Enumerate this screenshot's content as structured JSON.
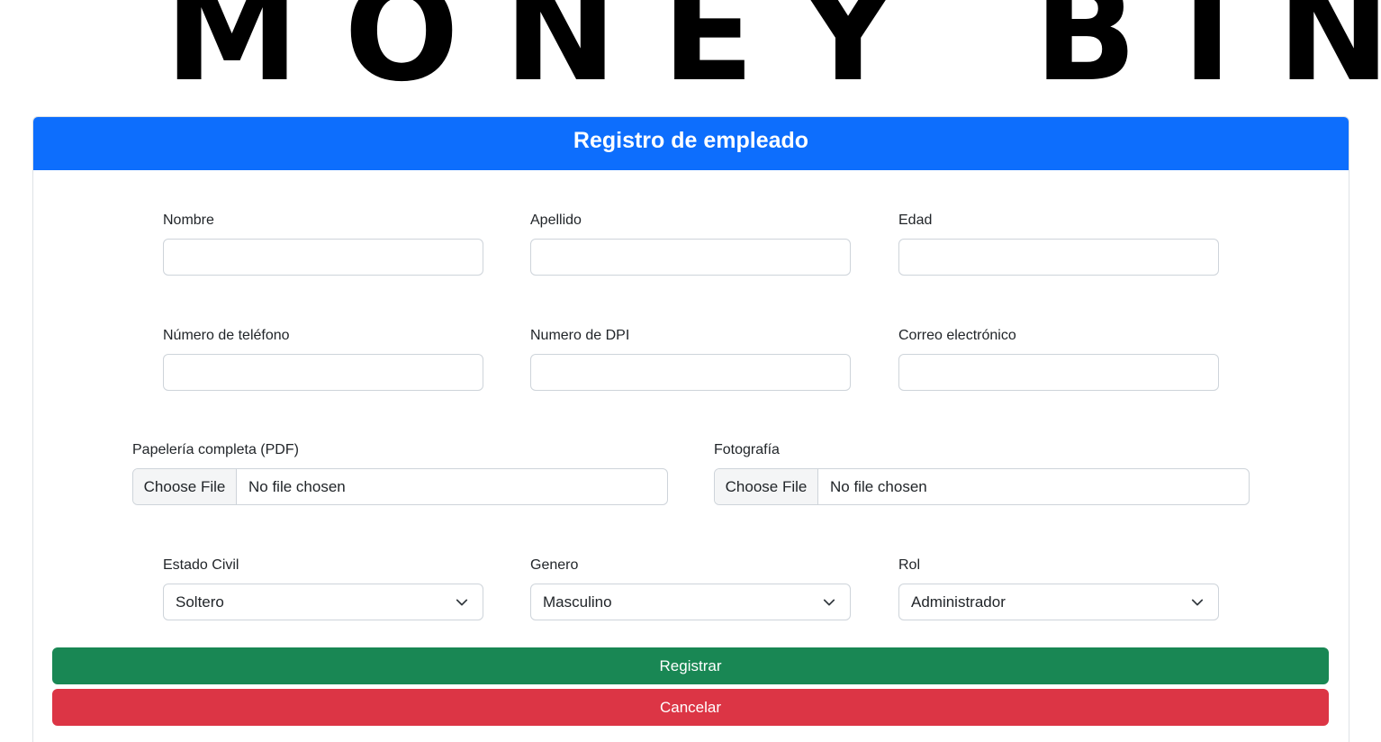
{
  "logo": {
    "text": "MONEY BIN"
  },
  "form": {
    "title": "Registro de empleado",
    "fields": {
      "nombre": {
        "label": "Nombre",
        "value": ""
      },
      "apellido": {
        "label": "Apellido",
        "value": ""
      },
      "edad": {
        "label": "Edad",
        "value": ""
      },
      "telefono": {
        "label": "Número de teléfono",
        "value": ""
      },
      "dpi": {
        "label": "Numero de DPI",
        "value": ""
      },
      "correo": {
        "label": "Correo electrónico",
        "value": ""
      }
    },
    "files": {
      "papeleria": {
        "label": "Papelería completa (PDF)",
        "button": "Choose File",
        "status": "No file chosen"
      },
      "fotografia": {
        "label": "Fotografía",
        "button": "Choose File",
        "status": "No file chosen"
      }
    },
    "selects": {
      "estado_civil": {
        "label": "Estado Civil",
        "selected": "Soltero"
      },
      "genero": {
        "label": "Genero",
        "selected": "Masculino"
      },
      "rol": {
        "label": "Rol",
        "selected": "Administrador"
      }
    },
    "buttons": {
      "registrar": "Registrar",
      "cancelar": "Cancelar"
    },
    "colors": {
      "header": "#0d6efd",
      "registrar": "#198754",
      "cancelar": "#dc3545"
    }
  }
}
